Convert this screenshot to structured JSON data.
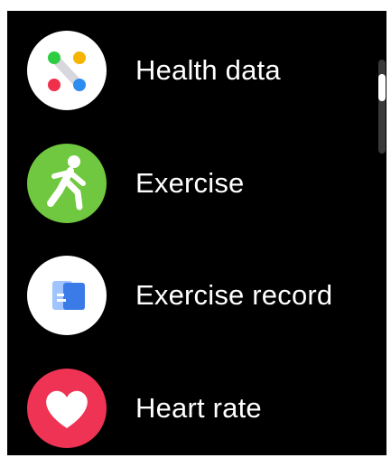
{
  "menu": {
    "items": [
      {
        "label": "Health data",
        "icon": "health-data-icon",
        "icon_bg": "#ffffff"
      },
      {
        "label": "Exercise",
        "icon": "running-person-icon",
        "icon_bg": "#6fc83f"
      },
      {
        "label": "Exercise record",
        "icon": "exercise-record-icon",
        "icon_bg": "#ffffff"
      },
      {
        "label": "Heart rate",
        "icon": "heart-icon",
        "icon_bg": "#ee3355"
      }
    ]
  },
  "colors": {
    "background": "#000000",
    "text": "#ffffff",
    "dot_green": "#2ecc40",
    "dot_yellow": "#f5b400",
    "dot_red": "#f0304a",
    "dot_blue": "#2d8cf0",
    "record_blue": "#3a7be8"
  },
  "scrollbar": {
    "position": 0.15
  }
}
